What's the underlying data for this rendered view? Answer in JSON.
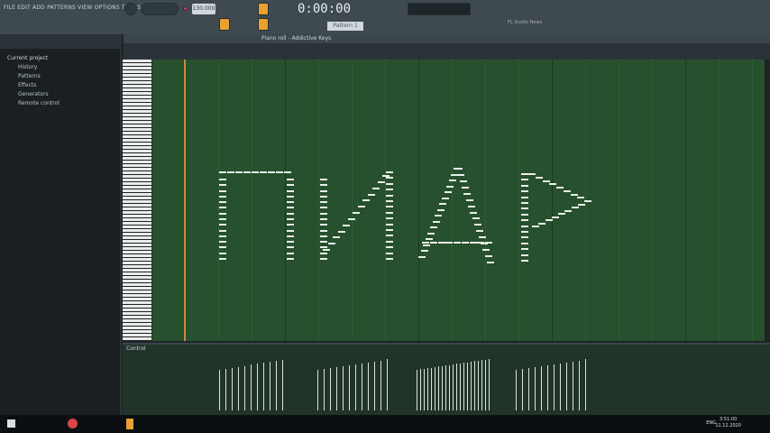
{
  "menu": "FILE EDIT ADD PATTERNS VIEW OPTIONS TOOLS HELP",
  "tempo": "130.000",
  "time": "0:00:00",
  "pattern": "Pattern 1",
  "hint": "FL Studio News",
  "browser": {
    "items": [
      "Current project",
      "History",
      "Patterns",
      "Effects",
      "Generators",
      "Remote control"
    ]
  },
  "piano_roll": {
    "title": "Piano roll - Addictive Keys",
    "control_label": "Control"
  },
  "taskbar": {
    "lang": "ENG",
    "time": "3:51:00",
    "date": "11.12.2020"
  },
  "colors": {
    "grid": "#27502e",
    "accent": "#e8a030",
    "note": "#e8f0e8"
  }
}
